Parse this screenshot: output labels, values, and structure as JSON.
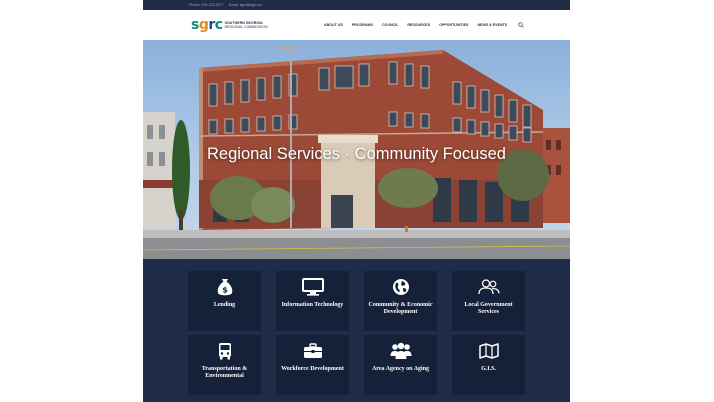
{
  "topbar": {
    "phone": "Phone: 229-333-5277",
    "email": "Email: sgrc@sgrc.us"
  },
  "logo": {
    "mark_1": "s",
    "mark_2": "g",
    "mark_3": "r",
    "mark_4": "c",
    "line_1": "SOUTHERN GEORGIA",
    "line_2": "REGIONAL COMMISSION"
  },
  "nav": {
    "items": [
      "ABOUT US",
      "PROGRAMS",
      "COUNCIL",
      "RESOURCES",
      "OPPORTUNITIES",
      "NEWS & EVENTS"
    ],
    "search_icon": "search-icon"
  },
  "hero": {
    "title": "Regional Services · Community Focused"
  },
  "services": [
    {
      "label": "Lending",
      "icon": "money-bag-icon"
    },
    {
      "label": "Information Technology",
      "icon": "monitor-icon"
    },
    {
      "label": "Community & Economic Development",
      "icon": "globe-icon"
    },
    {
      "label": "Local Government Services",
      "icon": "users-icon"
    },
    {
      "label": "Transportation & Environmental",
      "icon": "bus-icon"
    },
    {
      "label": "Workforce Development",
      "icon": "briefcase-icon"
    },
    {
      "label": "Area Agency on Aging",
      "icon": "group-icon"
    },
    {
      "label": "G.I.S.",
      "icon": "map-icon"
    }
  ],
  "colors": {
    "navy": "#1f2c48",
    "tile": "#152039",
    "teal": "#0f8c7e",
    "orange": "#e2891f",
    "blue": "#1a4f8f"
  }
}
